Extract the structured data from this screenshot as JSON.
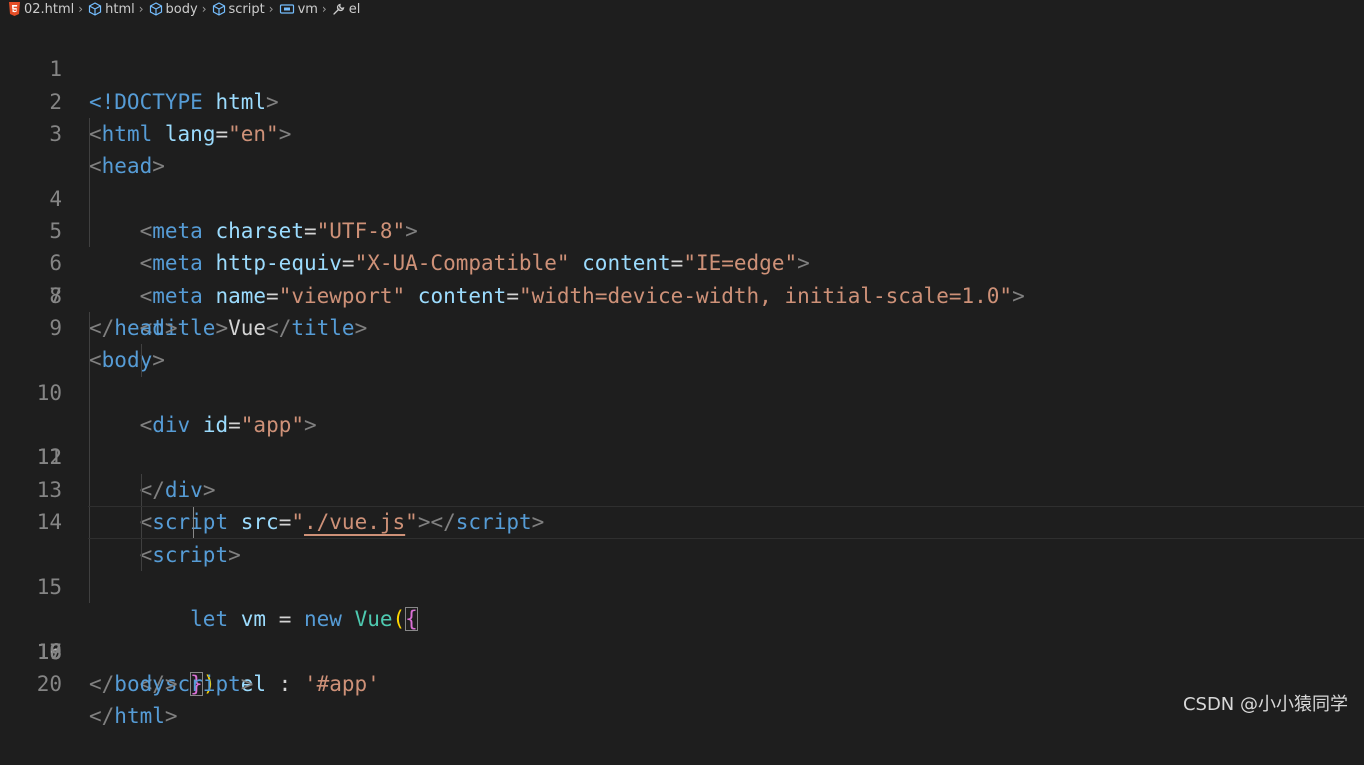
{
  "breadcrumb": {
    "file": "02.html",
    "items": [
      "html",
      "body",
      "script",
      "vm",
      "el"
    ]
  },
  "editor": {
    "line_numbers": [
      "1",
      "2",
      "3",
      "4",
      "5",
      "6",
      "7",
      "8",
      "9",
      "10",
      "11",
      "12",
      "13",
      "14",
      "15",
      "16",
      "17",
      "18",
      "19",
      "20"
    ],
    "current_line": "16",
    "tokens": {
      "doctype": "<!DOCTYPE",
      "html": "html",
      "lt": "<",
      "gt": ">",
      "lt_slash": "</",
      "eq": "=",
      "lang_attr": "lang",
      "lang_val": "\"en\"",
      "head": "head",
      "meta": "meta",
      "charset_attr": "charset",
      "charset_val": "\"UTF-8\"",
      "http_equiv_attr": "http-equiv",
      "http_equiv_val": "\"X-UA-Compatible\"",
      "content_attr": "content",
      "content_val_1": "\"IE=edge\"",
      "name_attr": "name",
      "name_val": "\"viewport\"",
      "content_val_2": "\"width=device-width, initial-scale=1.0\"",
      "title": "title",
      "title_text": "Vue",
      "body": "body",
      "div": "div",
      "id_attr": "id",
      "id_val": "\"app\"",
      "script": "script",
      "src_attr": "src",
      "quote": "\"",
      "src_val": "./vue.js",
      "let": "let",
      "vm": "vm",
      "assign": " = ",
      "new": "new",
      "vue_cls": "Vue",
      "paren_open": "(",
      "brace_open": "{",
      "el_key": "el",
      "colon": " : ",
      "el_val": "'#app'",
      "brace_close": "}",
      "paren_close": ")"
    }
  },
  "watermark": "CSDN @小小猿同学",
  "colors": {
    "background": "#1e1e1e",
    "tag": "#569cd6",
    "attribute": "#9cdcfe",
    "string": "#ce9178",
    "class": "#4ec9b0",
    "bracket_gold": "#ffd700",
    "bracket_pink": "#da70d6"
  }
}
